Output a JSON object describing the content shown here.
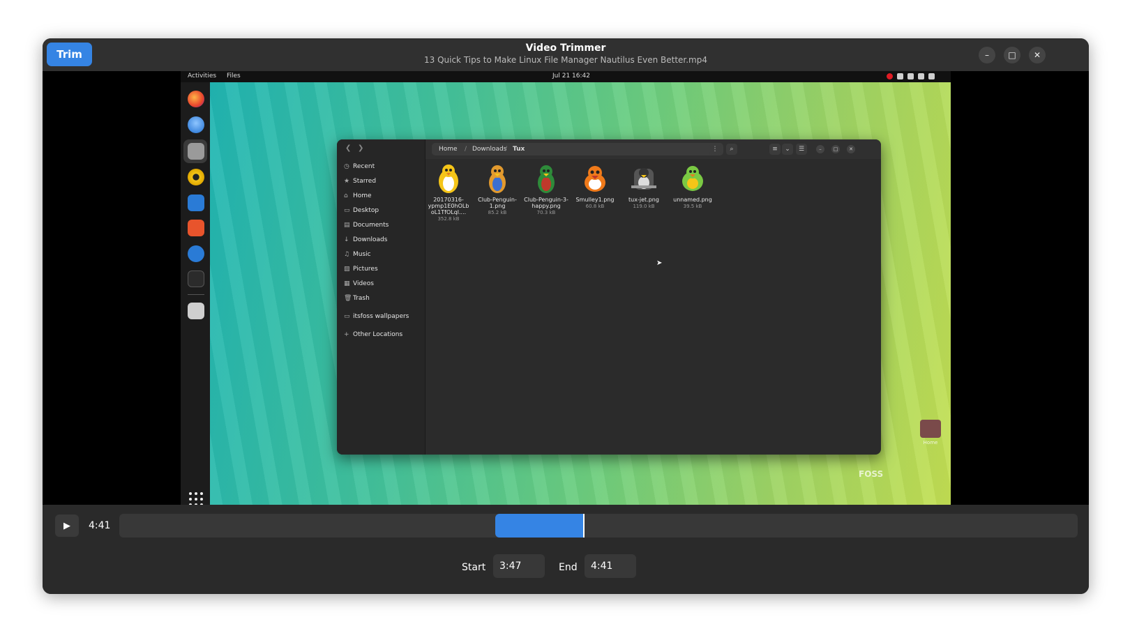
{
  "header": {
    "trim_label": "Trim",
    "title": "Video Trimmer",
    "subtitle": "13 Quick Tips to Make Linux File Manager Nautilus Even Better.mp4",
    "menu_icon": "hamburger-menu-icon",
    "window_buttons": [
      {
        "name": "minimize-button",
        "glyph": "–"
      },
      {
        "name": "maximize-button",
        "glyph": "□"
      },
      {
        "name": "close-button",
        "glyph": "✕"
      }
    ]
  },
  "video_frame": {
    "topbar": {
      "activities": "Activities",
      "app": "Files",
      "clock": "Jul 21  16:42"
    },
    "nautilus": {
      "path": {
        "home": "Home",
        "downloads": "Downloads",
        "current": "Tux"
      },
      "sidebar": [
        {
          "icon": "◷",
          "label": "Recent"
        },
        {
          "icon": "★",
          "label": "Starred"
        },
        {
          "icon": "⌂",
          "label": "Home"
        },
        {
          "icon": "▭",
          "label": "Desktop"
        },
        {
          "icon": "▤",
          "label": "Documents"
        },
        {
          "icon": "↓",
          "label": "Downloads"
        },
        {
          "icon": "♫",
          "label": "Music"
        },
        {
          "icon": "▨",
          "label": "Pictures"
        },
        {
          "icon": "▦",
          "label": "Videos"
        },
        {
          "icon": "🗑",
          "label": "Trash"
        },
        {
          "icon": "▭",
          "label": "itsfoss wallpapers"
        },
        {
          "icon": "+",
          "label": "Other Locations"
        }
      ],
      "files": [
        {
          "name": "20170316-ypmp1E0hOLb oL1TfOLql....",
          "size": "352.8 kB",
          "color": "#f5c518"
        },
        {
          "name": "Club-Penguin-1.png",
          "size": "85.2 kB",
          "color": "#e29a2e"
        },
        {
          "name": "Club-Penguin-3-happy.png",
          "size": "70.3 kB",
          "color": "#2e8b3a"
        },
        {
          "name": "Smulley1.png",
          "size": "60.8 kB",
          "color": "#f07a1a"
        },
        {
          "name": "tux-jet.png",
          "size": "119.0 kB",
          "color": "#555555"
        },
        {
          "name": "unnamed.png",
          "size": "39.5 kB",
          "color": "#7ac943"
        }
      ]
    },
    "desktop_home_label": "Home",
    "watermark": "FOSS"
  },
  "controls": {
    "play_icon": "▶",
    "current_time": "4:41",
    "selection": {
      "start_fraction": 0.392,
      "end_fraction": 0.485
    },
    "playhead_fraction": 0.485,
    "start_label": "Start",
    "start_value": "3:47",
    "end_label": "End",
    "end_value": "4:41"
  },
  "colors": {
    "accent": "#3584e4",
    "window_bg": "#242424",
    "headerbar_bg": "#303030"
  }
}
